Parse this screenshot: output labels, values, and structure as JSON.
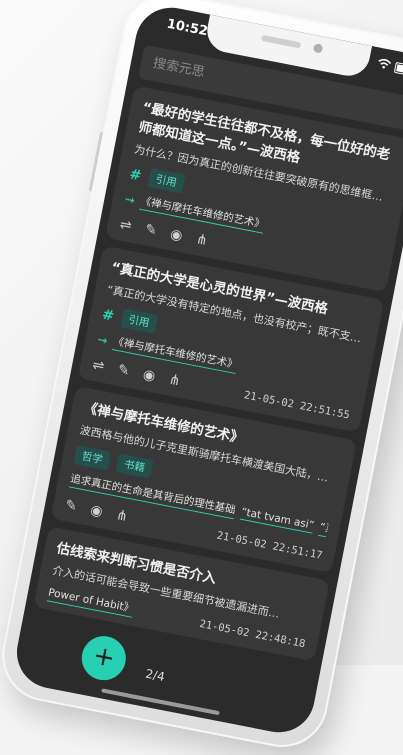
{
  "status": {
    "time": "10:52"
  },
  "search": {
    "placeholder": "搜索元思"
  },
  "cards": [
    {
      "title": "“最好的学生往往都不及格，每一位好的老师都知道这一点。”—波西格",
      "desc": "为什么？因为真正的创新往往要突破原有的思维框架。",
      "tags": [
        "引用"
      ],
      "refs": [
        "《禅与摩托车维修的艺术》"
      ],
      "date": ""
    },
    {
      "title": "“真正的大学是心灵的世界”—波西格",
      "desc": "“真正的大学没有特定的地点，也没有校产；既不支付薪…",
      "tags": [
        "引用"
      ],
      "refs": [
        "《禅与摩托车维修的艺术》"
      ],
      "date": "21-05-02 22:51:55"
    },
    {
      "title": "《禅与摩托车维修的艺术》",
      "desc": "波西格与他的儿子克里斯骑摩托车横渡美国大陆，在这…",
      "tags": [
        "哲学",
        "书籍"
      ],
      "refs": [
        "追求真正的生命是其背后的理性基础",
        "“tat tvam asi”",
        "“真正"
      ],
      "date": "21-05-02 22:51:17"
    },
    {
      "title": "估线索来判断习惯是否介入",
      "desc": "介入的话可能会导致一些重要细节被遗漏进而…",
      "tags": [],
      "refs": [
        "Power of Habit》"
      ],
      "date": "21-05-02 22:48:18"
    }
  ],
  "pager": {
    "text": "2/4"
  },
  "fab": {
    "label": "+"
  }
}
